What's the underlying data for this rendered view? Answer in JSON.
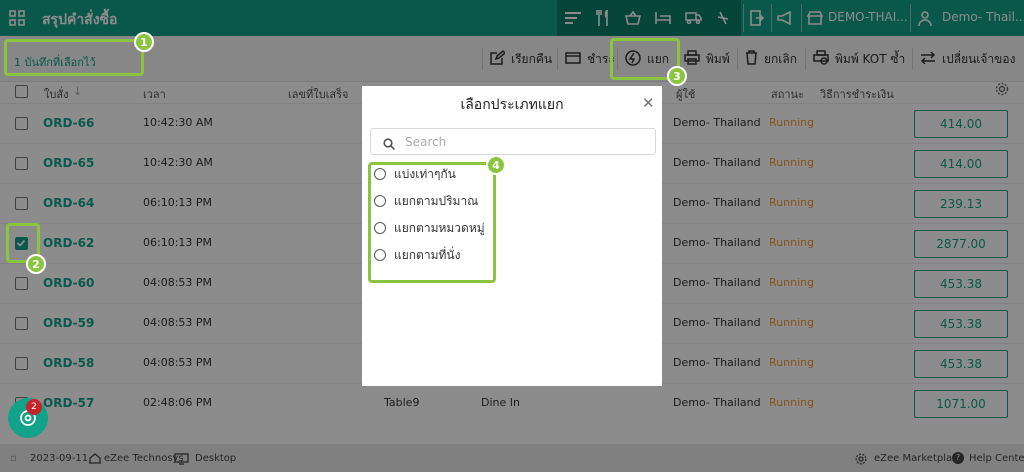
{
  "header": {
    "title": "สรุปคำสั่งซื้อ",
    "store_label": "DEMO-THAI...",
    "user_label": "Demo- Thail..."
  },
  "toolbar": {
    "selected_text": "1 บันทึกที่เลือกไว้",
    "buttons": [
      "เรียกคืน",
      "ชำระ",
      "แยก",
      "พิมพ์",
      "ยกเลิก",
      "พิมพ์ KOT ซ้ำ",
      "เปลี่ยนเจ้าของ"
    ]
  },
  "table": {
    "columns": [
      "ใบสั่ง",
      "เวลา",
      "เลขที่ใบเสร็จ",
      "ผู้ใช้",
      "สถานะ",
      "วิธีการชำระเงิน"
    ],
    "rows": [
      {
        "order": "ORD-66",
        "time": "10:42:30 AM",
        "table": "",
        "type": "",
        "user": "Demo- Thailand",
        "status": "Running",
        "amount": "414.00",
        "checked": false
      },
      {
        "order": "ORD-65",
        "time": "10:42:30 AM",
        "table": "",
        "type": "",
        "user": "Demo- Thailand",
        "status": "Running",
        "amount": "414.00",
        "checked": false
      },
      {
        "order": "ORD-64",
        "time": "06:10:13 PM",
        "table": "",
        "type": "",
        "user": "Demo- Thailand",
        "status": "Running",
        "amount": "239.13",
        "checked": false
      },
      {
        "order": "ORD-62",
        "time": "06:10:13 PM",
        "table": "",
        "type": "",
        "user": "Demo- Thailand",
        "status": "Running",
        "amount": "2877.00",
        "checked": true
      },
      {
        "order": "ORD-60",
        "time": "04:08:53 PM",
        "table": "",
        "type": "",
        "user": "Demo- Thailand",
        "status": "Running",
        "amount": "453.38",
        "checked": false
      },
      {
        "order": "ORD-59",
        "time": "04:08:53 PM",
        "table": "",
        "type": "",
        "user": "Demo- Thailand",
        "status": "Running",
        "amount": "453.38",
        "checked": false
      },
      {
        "order": "ORD-58",
        "time": "04:08:53 PM",
        "table": "",
        "type": "",
        "user": "Demo- Thailand",
        "status": "Running",
        "amount": "453.38",
        "checked": false
      },
      {
        "order": "ORD-57",
        "time": "02:48:06 PM",
        "table": "Table9",
        "type": "Dine In",
        "user": "Demo- Thailand",
        "status": "Running",
        "amount": "1071.00",
        "checked": false
      }
    ]
  },
  "modal": {
    "title": "เลือกประเภทแยก",
    "search_placeholder": "Search",
    "options": [
      "แบ่งเท่าๆกัน",
      "แยกตามปริมาณ",
      "แยกตามหมวดหมู่",
      "แยกตามที่นั่ง"
    ]
  },
  "badges": [
    "1",
    "2",
    "3",
    "4"
  ],
  "fab_badge": "2",
  "footer": {
    "date": "2023-09-11",
    "company": "eZee Technosys",
    "device": "Desktop",
    "marketplace": "eZee Marketplace",
    "help": "Help Center"
  },
  "colors": {
    "primary": "#12a189",
    "primary_dark": "#0b7e6b",
    "running": "#f29a2e",
    "highlight": "#8bc540",
    "badge_red": "#c6242b"
  }
}
